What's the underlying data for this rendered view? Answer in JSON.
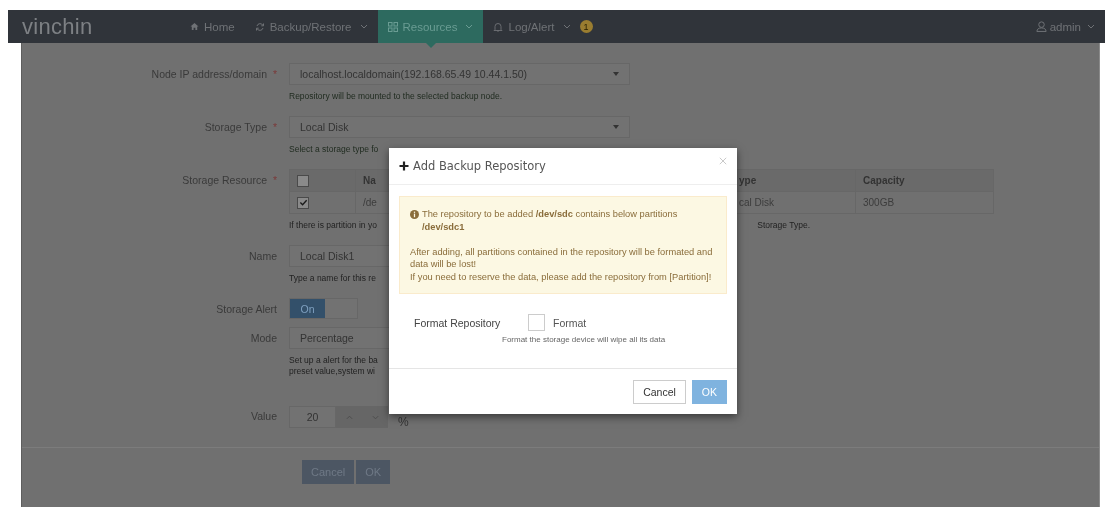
{
  "navbar": {
    "logo": "vinchin",
    "items": [
      {
        "label": "Home",
        "dropdown": false,
        "selected": false
      },
      {
        "label": "Backup/Restore",
        "dropdown": true,
        "selected": false
      },
      {
        "label": "Resources",
        "dropdown": true,
        "selected": true
      },
      {
        "label": "Log/Alert",
        "dropdown": true,
        "selected": false,
        "badge": "1"
      }
    ],
    "user": "admin"
  },
  "form": {
    "fields": [
      {
        "kind": "select",
        "label": "Node IP address/domain",
        "required_mark": "*",
        "value": "localhost.localdomain(192.168.65.49 10.44.1.50)",
        "hint": [
          "Repository will be mounted to the selected backup node."
        ]
      },
      {
        "kind": "select",
        "label": "Storage Type",
        "required_mark": "*",
        "value": "Local Disk",
        "hint": [
          "Select a storage type fo"
        ]
      },
      {
        "kind": "table",
        "label": "Storage Resource",
        "required_mark": "*",
        "header_checked": false,
        "columns": [
          "Na",
          "ype",
          "Capacity"
        ],
        "rows": [
          {
            "checked": true,
            "cells": [
              "/de",
              "cal Disk",
              "300GB"
            ]
          }
        ],
        "hint": [
          "If there is partition in yo"
        ],
        "hint_right": "Storage Type."
      },
      {
        "kind": "text",
        "label": "Name",
        "value": "Local Disk1",
        "hint": [
          "Type a name for this re"
        ]
      },
      {
        "kind": "toggle",
        "label": "Storage Alert",
        "on": true,
        "on_label": "On"
      },
      {
        "kind": "text",
        "label": "Mode",
        "value": "Percentage",
        "hint": [
          "Set up a alert for the ba",
          "preset value,system wi"
        ]
      },
      {
        "kind": "spinner",
        "label": "Value",
        "value": "20",
        "unit": "%"
      }
    ],
    "buttons": [
      "Cancel",
      "OK"
    ]
  },
  "dialog": {
    "title": "Add Backup Repository",
    "alert": [
      "The repository to be added **/dev/sdc** contains below partitions **/dev/sdc1**",
      "After adding, all partitions contained in the repository will be formated and data will be lost!",
      "If you need to reserve the data, please add the repository from [Partition]!"
    ],
    "option": {
      "label": "Format Repository",
      "checkbox_label": "Format",
      "checked": false,
      "hint": "Format the storage device will wipe all its data"
    },
    "buttons": [
      "Cancel",
      "OK"
    ]
  }
}
